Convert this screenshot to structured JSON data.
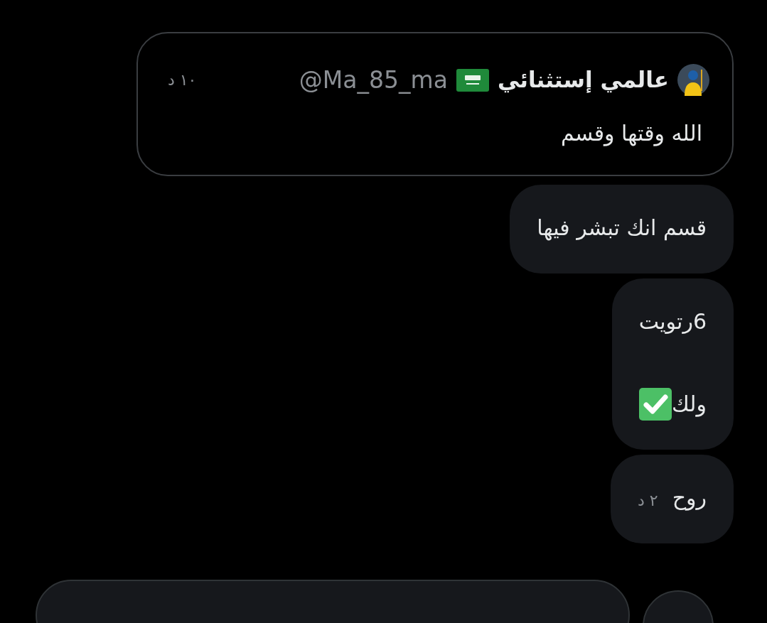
{
  "quoted_tweet": {
    "name": "عالمي إستثنائي",
    "handle": "@Ma_85_ma",
    "time": "١٠ د",
    "text": "الله وقتها وقسم"
  },
  "messages": [
    {
      "paragraphs": [
        {
          "kind": "plain",
          "text": "قسم انك تبشر فيها"
        }
      ]
    },
    {
      "paragraphs": [
        {
          "kind": "plain",
          "text": "6رتويت"
        },
        {
          "kind": "checkmark",
          "text": "ولك"
        }
      ]
    },
    {
      "paragraphs": [
        {
          "kind": "plain",
          "text": "روح",
          "time": "٢ د"
        }
      ]
    }
  ]
}
